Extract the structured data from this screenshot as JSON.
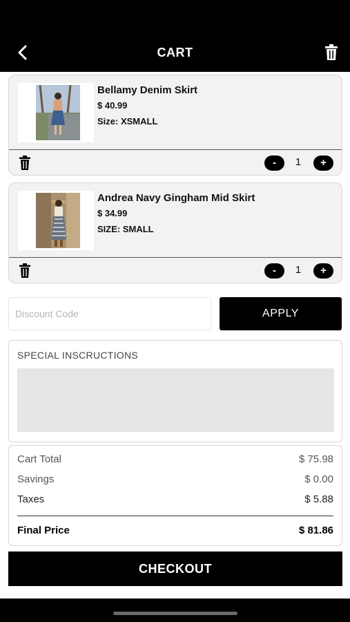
{
  "header": {
    "title": "CART",
    "back_icon": "chevron-left-icon",
    "clear_icon": "trash-icon"
  },
  "items": [
    {
      "name": "Bellamy Denim Skirt",
      "price": "$ 40.99",
      "size": "Size: XSMALL",
      "quantity": "1",
      "minus_label": "-",
      "plus_label": "+",
      "image": "denim-skirt-photo"
    },
    {
      "name": "Andrea Navy Gingham Mid Skirt",
      "price": "$ 34.99",
      "size": "SIZE: SMALL",
      "quantity": "1",
      "minus_label": "-",
      "plus_label": "+",
      "image": "gingham-skirt-photo"
    }
  ],
  "discount": {
    "placeholder": "Discount Code",
    "value": "",
    "apply_label": "APPLY"
  },
  "instructions": {
    "label": "SPECIAL INSCRUCTIONS",
    "value": ""
  },
  "summary": {
    "rows": [
      {
        "label": "Cart Total",
        "value": "$ 75.98"
      },
      {
        "label": "Savings",
        "value": "$ 0.00"
      },
      {
        "label": "Taxes",
        "value": "$ 5.88"
      }
    ],
    "final": {
      "label": "Final Price",
      "value": "$ 81.86"
    }
  },
  "checkout_label": "CHECKOUT",
  "colors": {
    "primary": "#000000",
    "card_bg": "#f2f2f2",
    "textarea_bg": "#e6e6e6"
  }
}
